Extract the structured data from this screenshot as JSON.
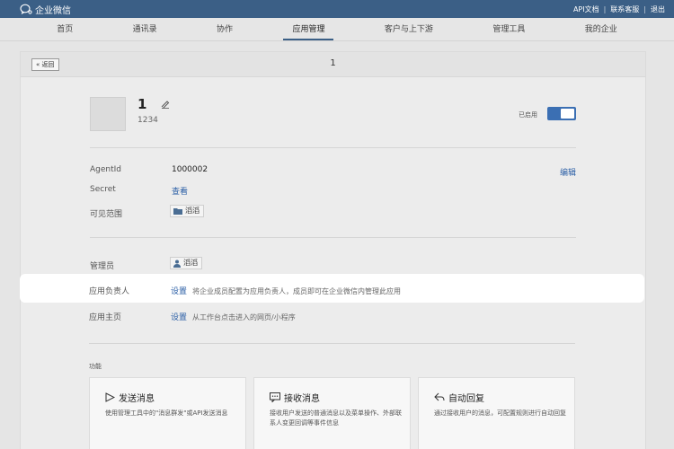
{
  "topbar": {
    "brand": "企业微信",
    "links": [
      "API文档",
      "联系客服",
      "退出"
    ]
  },
  "nav": {
    "items": [
      "首页",
      "通讯录",
      "协作",
      "应用管理",
      "客户与上下游",
      "管理工具",
      "我的企业"
    ],
    "active_index": 3
  },
  "panel": {
    "back_label": "返回",
    "title": "1"
  },
  "app": {
    "name": "1",
    "id": "1234",
    "status_label": "已启用",
    "enabled": true
  },
  "details": {
    "agentid_label": "AgentId",
    "agentid_value": "1000002",
    "edit_label": "编辑",
    "secret_label": "Secret",
    "secret_action": "查看",
    "scope_label": "可见范围",
    "scope_value": "滔滔"
  },
  "roles": {
    "admin_label": "管理员",
    "admin_value": "滔滔",
    "owner_label": "应用负责人",
    "owner_action": "设置",
    "owner_desc": "将企业成员配置为应用负责人，成员即可在企业微信内管理此应用",
    "homepage_label": "应用主页",
    "homepage_action": "设置",
    "homepage_desc": "从工作台点击进入的网页/小程序"
  },
  "functions": {
    "section_label": "功能",
    "cards": [
      {
        "icon": "send-icon",
        "title": "发送消息",
        "desc": "使用管理工具中的\"消息群发\"或API发送消息"
      },
      {
        "icon": "message-icon",
        "title": "接收消息",
        "desc": "接收用户发送的普通消息以及菜单操作、外部联系人变更回调等事件信息"
      },
      {
        "icon": "reply-icon",
        "title": "自动回复",
        "desc": "通过接收用户的消息，可配置规则进行自动回复"
      }
    ]
  },
  "colors": {
    "topbar": "#3b5f86",
    "toggle": "#3b6fb3",
    "link": "#2b5fa6"
  }
}
